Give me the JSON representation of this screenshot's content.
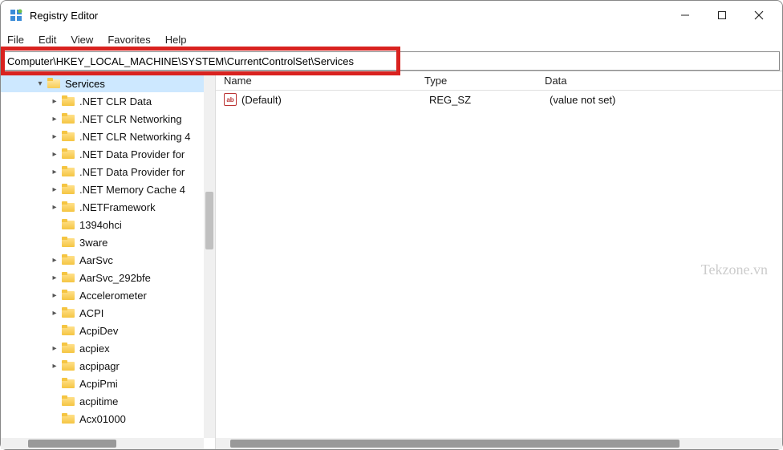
{
  "window": {
    "title": "Registry Editor"
  },
  "menu": {
    "file": "File",
    "edit": "Edit",
    "view": "View",
    "favorites": "Favorites",
    "help": "Help"
  },
  "address": {
    "path": "Computer\\HKEY_LOCAL_MACHINE\\SYSTEM\\CurrentControlSet\\Services"
  },
  "tree": {
    "root": {
      "label": "Services",
      "expanded": true
    },
    "items": [
      {
        "label": ".NET CLR Data",
        "chev": true
      },
      {
        "label": ".NET CLR Networking",
        "chev": true
      },
      {
        "label": ".NET CLR Networking 4",
        "chev": true
      },
      {
        "label": ".NET Data Provider for",
        "chev": true
      },
      {
        "label": ".NET Data Provider for",
        "chev": true
      },
      {
        "label": ".NET Memory Cache 4",
        "chev": true
      },
      {
        "label": ".NETFramework",
        "chev": true
      },
      {
        "label": "1394ohci",
        "chev": false
      },
      {
        "label": "3ware",
        "chev": false
      },
      {
        "label": "AarSvc",
        "chev": true
      },
      {
        "label": "AarSvc_292bfe",
        "chev": true
      },
      {
        "label": "Accelerometer",
        "chev": true
      },
      {
        "label": "ACPI",
        "chev": true
      },
      {
        "label": "AcpiDev",
        "chev": false
      },
      {
        "label": "acpiex",
        "chev": true
      },
      {
        "label": "acpipagr",
        "chev": true
      },
      {
        "label": "AcpiPmi",
        "chev": false
      },
      {
        "label": "acpitime",
        "chev": false
      },
      {
        "label": "Acx01000",
        "chev": false
      }
    ]
  },
  "list": {
    "headers": {
      "name": "Name",
      "type": "Type",
      "data": "Data"
    },
    "rows": [
      {
        "name": "(Default)",
        "type": "REG_SZ",
        "data": "(value not set)",
        "icon": "ab"
      }
    ]
  },
  "watermark": "Tekzone.vn"
}
